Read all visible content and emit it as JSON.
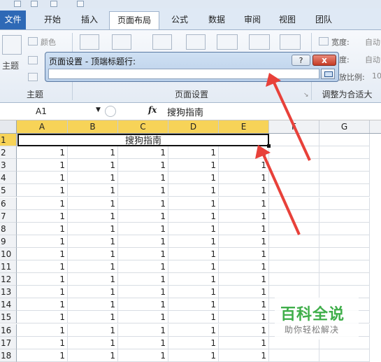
{
  "tabs": [
    "文件",
    "开始",
    "插入",
    "页面布局",
    "公式",
    "数据",
    "审阅",
    "视图",
    "团队"
  ],
  "ribbon": {
    "theme_label": "主题",
    "colors_label": "颜色",
    "width_label": "宽度:",
    "height_label": "高度:",
    "scale_label": "缩放比例:",
    "auto_label": "自动",
    "scale_value": "10",
    "group_theme": "主题",
    "group_page_setup": "页面设置",
    "group_fit": "调整为合适大"
  },
  "dialog": {
    "title": "页面设置 - 顶端标题行:",
    "help_label": "?",
    "close_label": "x",
    "input_value": ""
  },
  "formula_bar": {
    "name_box": "A1",
    "fx_label": "fx",
    "content": "搜狗指南"
  },
  "sheet": {
    "columns": [
      "A",
      "B",
      "C",
      "D",
      "E",
      "F",
      "G"
    ],
    "rows": [
      "1",
      "2",
      "3",
      "4",
      "5",
      "6",
      "7",
      "8",
      "9",
      "10",
      "11",
      "12",
      "13",
      "14",
      "15",
      "16",
      "17",
      "18"
    ],
    "merged_title": "搜狗指南",
    "cell_value": "1"
  },
  "annotations": {
    "arrow_color": "#e8413a"
  },
  "watermark": {
    "main": "百科全说",
    "sub": "助你轻松解决"
  }
}
